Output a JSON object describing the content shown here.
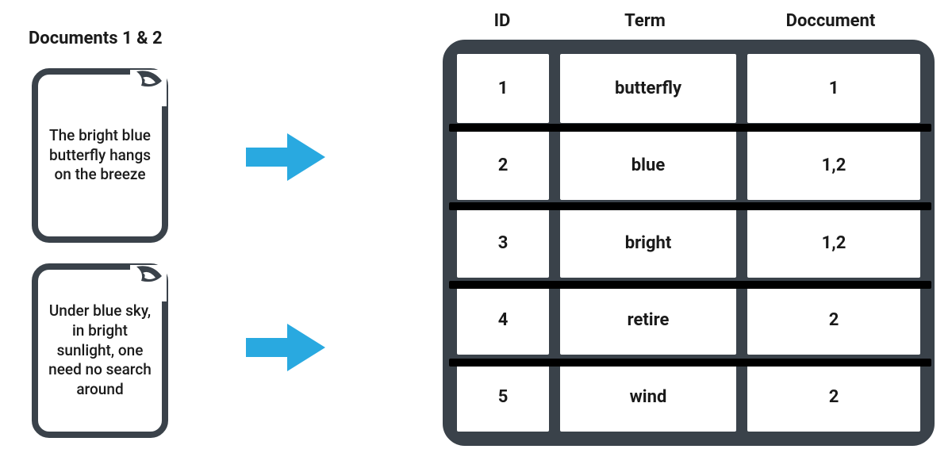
{
  "title": "Documents 1 & 2",
  "documents": [
    {
      "text": "The bright blue butterfly hangs on the breeze"
    },
    {
      "text": "Under blue sky, in bright sunlight, one need no search around"
    }
  ],
  "headers": {
    "id": "ID",
    "term": "Term",
    "doc": "Doccument"
  },
  "rows": [
    {
      "id": "1",
      "term": "butterfly",
      "doc": "1"
    },
    {
      "id": "2",
      "term": "blue",
      "doc": "1,2"
    },
    {
      "id": "3",
      "term": "bright",
      "doc": "1,2"
    },
    {
      "id": "4",
      "term": "retire",
      "doc": "2"
    },
    {
      "id": "5",
      "term": "wind",
      "doc": "2"
    }
  ],
  "colors": {
    "frame": "#3a424a",
    "arrow": "#29a9e0"
  }
}
